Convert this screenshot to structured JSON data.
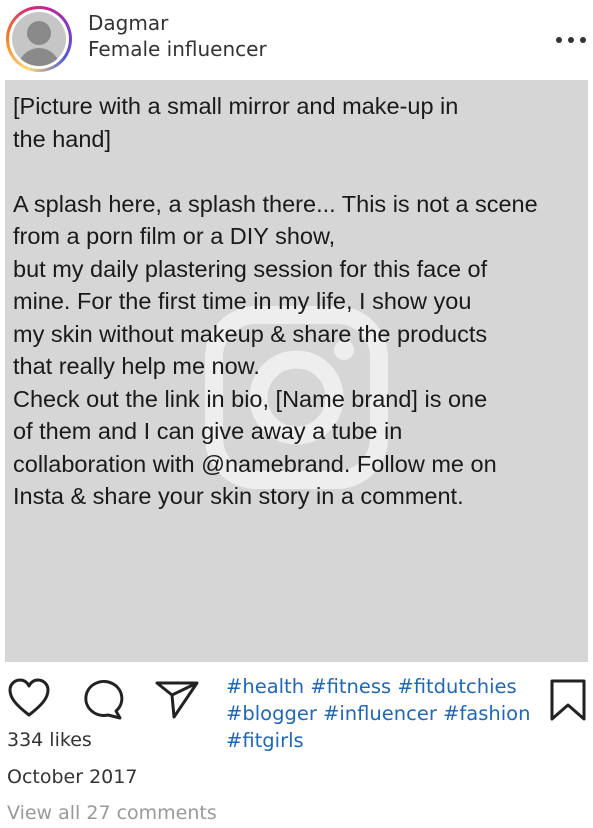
{
  "post": {
    "username": "Dagmar",
    "subtitle": "Female influencer",
    "more_icon": "more-horizontal-icon",
    "image_bg": "#d6d6d6",
    "caption": {
      "line1": "[Picture with a small mirror and make-up in",
      "line2": "the hand]",
      "line3": "A splash here, a splash there... This is not a scene",
      "line4": "from a porn film or a DIY show,",
      "line5": "but my daily plastering session for this face of",
      "line6": "mine. For the first time in my life, I show you",
      "line7": "my skin without makeup & share the products",
      "line8": "that really help me now.",
      "line9": "Check out the link in bio, [Name brand] is one",
      "line10": "of them and I can give away a tube in",
      "line11": "collaboration with @namebrand. Follow me on",
      "line12": "Insta & share your skin story in a comment."
    },
    "actions": {
      "like_icon": "heart-icon",
      "comment_icon": "comment-icon",
      "share_icon": "send-icon",
      "save_icon": "bookmark-icon"
    },
    "hashtags": {
      "line1": "#health #fitness #fitdutchies",
      "line2": "#blogger #influencer #fashion",
      "line3": "#fitgirls"
    },
    "likes": "334 likes",
    "date": "October 2017",
    "view_comments": "View all 27 comments",
    "colors": {
      "hashtag": "#1f67b8",
      "muted": "#9a9a9a",
      "text": "#333333"
    }
  }
}
